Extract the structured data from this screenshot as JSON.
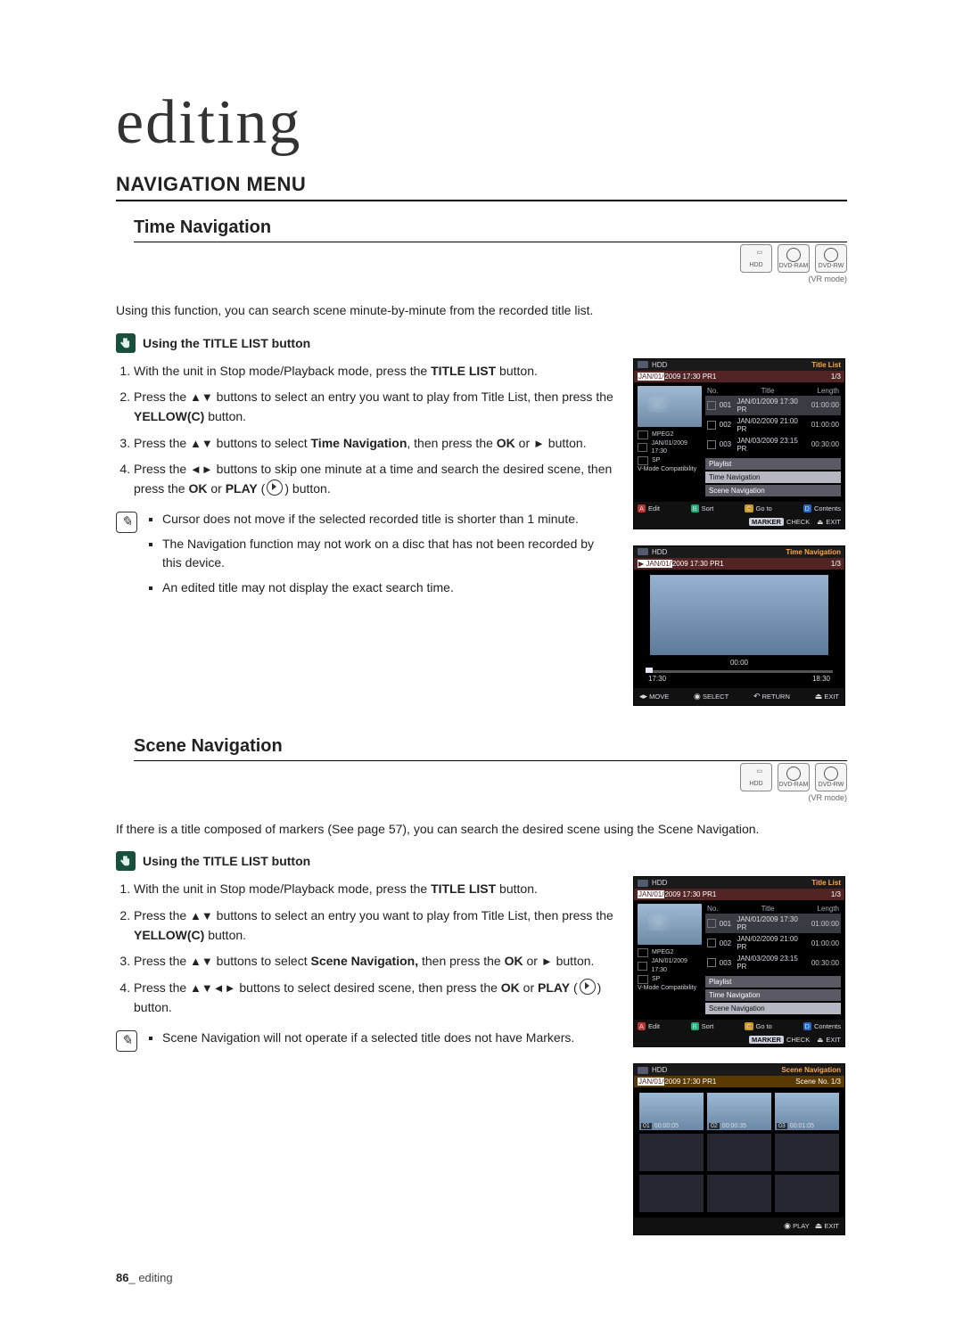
{
  "chapter": "editing",
  "section_main": "NAVIGATION MENU",
  "time_nav": {
    "heading": "Time Navigation",
    "intro": "Using this function, you can search scene minute-by-minute from the recorded title list.",
    "touch_label": "Using the TITLE LIST button",
    "steps": {
      "s1a": "With the unit in Stop mode/Playback mode, press the ",
      "s1b": "TITLE LIST",
      "s1c": " button.",
      "s2a": "Press the ",
      "s2b": " buttons to select an entry you want to play from Title List, then press the ",
      "s2c": "YELLOW(C)",
      "s2d": " button.",
      "s3a": "Press the ",
      "s3b": " buttons to select ",
      "s3c": "Time Navigation",
      "s3d": ", then press the ",
      "s3e": "OK",
      "s3f": " or ",
      "s3g": " button.",
      "s4a": "Press the ",
      "s4b": " buttons to skip one minute at a time and search the desired scene, then press the ",
      "s4c": "OK",
      "s4d": " or ",
      "s4e": "PLAY",
      "s4f": " button."
    },
    "notes": {
      "n1": "Cursor does not move if the selected recorded title is shorter than 1 minute.",
      "n2": "The Navigation function may not work on a disc that has not been recorded by this device.",
      "n3": "An edited title may not display the exact search time."
    }
  },
  "scene_nav": {
    "heading": "Scene Navigation",
    "intro": "If there is a title composed of markers (See page 57), you can search the desired scene using the Scene Navigation.",
    "touch_label": "Using the TITLE LIST button",
    "steps": {
      "s1a": "With the unit in Stop mode/Playback mode, press the ",
      "s1b": "TITLE LIST",
      "s1c": " button.",
      "s2a": "Press the ",
      "s2b": " buttons to select an entry you want to play from Title List, then press the ",
      "s2c": "YELLOW(C)",
      "s2d": " button.",
      "s3a": "Press the ",
      "s3b": " buttons to select ",
      "s3c": "Scene Navigation,",
      "s3d": " then press the ",
      "s3e": "OK",
      "s3f": " or ",
      "s3g": " button.",
      "s4a": "Press the ",
      "s4b": " buttons to select desired scene, then press the ",
      "s4c": "OK",
      "s4d": " or ",
      "s4e": "PLAY",
      "s4f": " button."
    },
    "notes": {
      "n1": "Scene Navigation will not operate if a selected title does not have Markers."
    }
  },
  "badges": {
    "hdd": "HDD",
    "ram": "DVD-RAM",
    "rw": "DVD-RW",
    "vr": "(VR mode)"
  },
  "osd_titlelist": {
    "drive": "HDD",
    "header_title": "Title List",
    "stripe_date": "JAN/01/2009 17:30 PR1",
    "stripe_count": "1/3",
    "columns": {
      "no": "No.",
      "title": "Title",
      "length": "Length"
    },
    "rows": [
      {
        "no": "001",
        "title": "JAN/01/2009 17:30 PR",
        "length": "01:00:00"
      },
      {
        "no": "002",
        "title": "JAN/02/2009 21:00 PR",
        "length": "01:00:00"
      },
      {
        "no": "003",
        "title": "JAN/03/2009 23:15 PR",
        "length": "00:30:00"
      }
    ],
    "meta": {
      "codec": "MPEG2",
      "datetime": "JAN/01/2009 17:30",
      "mode": "SP",
      "compat": "V-Mode Compatibility"
    },
    "menu": {
      "playlist": "Playlist",
      "time_nav": "Time Navigation",
      "scene_nav": "Scene Navigation"
    },
    "foot": {
      "edit": "Edit",
      "sort": "Sort",
      "goto": "Go to",
      "contents": "Contents",
      "marker": "MARKER",
      "check": "CHECK",
      "exit": "EXIT"
    }
  },
  "osd_timenav": {
    "drive": "HDD",
    "header_title": "Time Navigation",
    "stripe_date": "JAN/01/2009 17:30 PR1",
    "stripe_count": "1/3",
    "current": "00:00",
    "start": "17:30",
    "end": "18:30",
    "foot": {
      "move": "MOVE",
      "select": "SELECT",
      "return": "RETURN",
      "exit": "EXIT"
    }
  },
  "osd_scenenav": {
    "drive": "HDD",
    "header_title": "Scene Navigation",
    "stripe_date": "JAN/01/2009 17:30 PR1",
    "stripe_count": "Scene No.  1/3",
    "cells": [
      {
        "no": "01",
        "t": "00:00:05"
      },
      {
        "no": "02",
        "t": "00:00:35"
      },
      {
        "no": "03",
        "t": "00:01:05"
      }
    ],
    "foot": {
      "play": "PLAY",
      "exit": "EXIT"
    }
  },
  "footer": {
    "page_num": "86",
    "sep": "_ ",
    "chapter": "editing"
  }
}
